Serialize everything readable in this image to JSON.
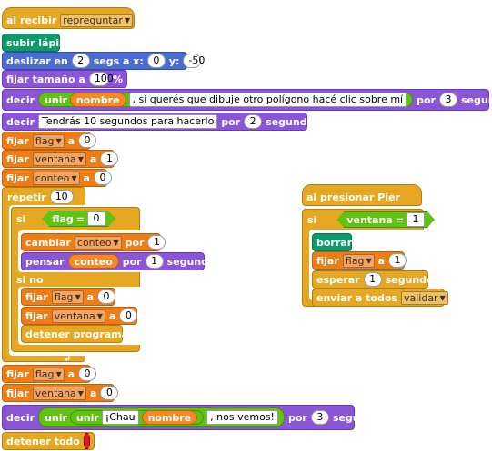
{
  "script_main": {
    "hat": {
      "label": "al recibir",
      "message": "repreguntar"
    },
    "pen_up": "subir lápiz",
    "glide": {
      "label_1": "deslizar en",
      "secs": "2",
      "label_2": "segs a x:",
      "x": "0",
      "label_3": "y:",
      "y": "-50"
    },
    "set_size": {
      "label": "fijar tamaño a",
      "value": "100",
      "unit": "%"
    },
    "say_1": {
      "label": "decir",
      "join": "unir",
      "var": "nombre",
      "text": ", si querés que dibuje otro polígono hacé clic sobre mí",
      "for": "por",
      "secs": "3",
      "unit": "segundos"
    },
    "say_2": {
      "label": "decir",
      "text": "Tendrás 10 segundos para hacerlo",
      "for": "por",
      "secs": "2",
      "unit": "segundos"
    },
    "set_flag": {
      "label": "fijar",
      "var": "flag",
      "to": "a",
      "value": "0"
    },
    "set_ventana": {
      "label": "fijar",
      "var": "ventana",
      "to": "a",
      "value": "1"
    },
    "set_conteo": {
      "label": "fijar",
      "var": "conteo",
      "to": "a",
      "value": "0"
    },
    "repeat": {
      "label": "repetir",
      "times": "10"
    },
    "if": {
      "label": "si",
      "var": "flag",
      "op": "=",
      "value": "0"
    },
    "change": {
      "label": "cambiar",
      "var": "conteo",
      "by": "por",
      "value": "1"
    },
    "think": {
      "label": "pensar",
      "var": "conteo",
      "for": "por",
      "secs": "1",
      "unit": "segundos"
    },
    "else": "si no",
    "else_set_flag": {
      "label": "fijar",
      "var": "flag",
      "to": "a",
      "value": "0"
    },
    "else_set_ventana": {
      "label": "fijar",
      "var": "ventana",
      "to": "a",
      "value": "0"
    },
    "stop_program": "detener programa",
    "after_set_flag": {
      "label": "fijar",
      "var": "flag",
      "to": "a",
      "value": "0"
    },
    "after_set_ventana": {
      "label": "fijar",
      "var": "ventana",
      "to": "a",
      "value": "0"
    },
    "say_3": {
      "label": "decir",
      "join_outer": "unir",
      "join_inner": "unir",
      "text_1": "¡Chau",
      "var": "nombre",
      "text_2": ", nos vemos!",
      "for": "por",
      "secs": "3",
      "unit": "segundos"
    },
    "stop_all": "detener todo"
  },
  "script_pier": {
    "hat": "al presionar Pier",
    "if": {
      "label": "si",
      "var": "ventana",
      "op": "=",
      "value": "1"
    },
    "clear": "borrar",
    "set_flag": {
      "label": "fijar",
      "var": "flag",
      "to": "a",
      "value": "1"
    },
    "wait": {
      "label": "esperar",
      "secs": "1",
      "unit": "segundos"
    },
    "broadcast": {
      "label": "enviar a todos",
      "message": "validar"
    }
  },
  "colors": {
    "control": "#e6a822",
    "motion": "#4a6cd4",
    "looks": "#8a55d7",
    "variables": "#ee7d16",
    "pen": "#0e9a6c",
    "operators": "#62c213"
  }
}
